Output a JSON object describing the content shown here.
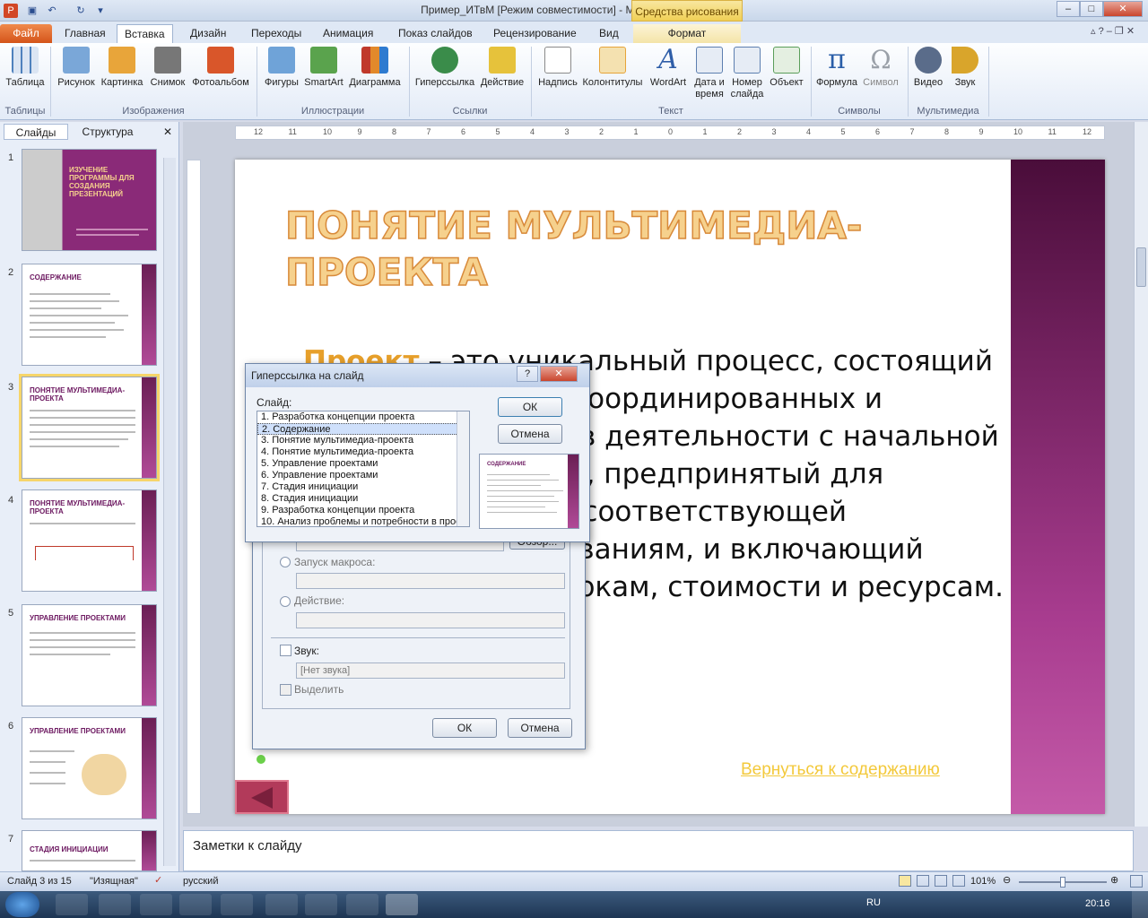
{
  "window": {
    "title": "Пример_ИТвМ [Режим совместимости] - Microsoft PowerPoint",
    "contextual_group": "Средства рисования"
  },
  "tabs": [
    "Файл",
    "Главная",
    "Вставка",
    "Дизайн",
    "Переходы",
    "Анимация",
    "Показ слайдов",
    "Рецензирование",
    "Вид",
    "Формат"
  ],
  "ribbon": {
    "buttons": [
      {
        "label": "Таблица",
        "icon": "table-icon",
        "color": "#4f81bd"
      },
      {
        "label": "Рисунок",
        "icon": "picture-icon",
        "color": "#7aa7d8"
      },
      {
        "label": "Картинка",
        "icon": "clipart-icon",
        "color": "#e8a53a"
      },
      {
        "label": "Снимок",
        "icon": "screenshot-icon",
        "color": "#777777"
      },
      {
        "label": "Фотоальбом",
        "icon": "photo-album-icon",
        "color": "#d9562a"
      },
      {
        "label": "Фигуры",
        "icon": "shapes-icon",
        "color": "#6fa3d8"
      },
      {
        "label": "SmartArt",
        "icon": "smartart-icon",
        "color": "#5aa34d"
      },
      {
        "label": "Диаграмма",
        "icon": "chart-icon",
        "color": "#e2892b"
      },
      {
        "label": "Гиперссылка",
        "icon": "hyperlink-icon",
        "color": "#3a8c4a"
      },
      {
        "label": "Действие",
        "icon": "action-icon",
        "color": "#e6c23b"
      },
      {
        "label": "Надпись",
        "icon": "textbox-icon",
        "color": "#8a8a8a"
      },
      {
        "label": "Колонтитулы",
        "icon": "header-footer-icon",
        "color": "#e7a43a"
      },
      {
        "label": "WordArt",
        "icon": "wordart-icon",
        "color": "#2f5ea8"
      },
      {
        "label": "Дата и время",
        "icon": "datetime-icon",
        "color": "#5d7fb0"
      },
      {
        "label": "Номер слайда",
        "icon": "slide-number-icon",
        "color": "#5d7fb0"
      },
      {
        "label": "Объект",
        "icon": "object-icon",
        "color": "#5a9e5a"
      },
      {
        "label": "Формула",
        "icon": "formula-icon",
        "color": "#2a5ea8"
      },
      {
        "label": "Символ",
        "icon": "symbol-icon",
        "color": "#9aa0a8"
      },
      {
        "label": "Видео",
        "icon": "video-icon",
        "color": "#5a6c8a"
      },
      {
        "label": "Звук",
        "icon": "sound-icon",
        "color": "#d9a52b"
      }
    ],
    "groups": [
      "Таблицы",
      "Изображения",
      "Иллюстрации",
      "Ссылки",
      "Текст",
      "Символы",
      "Мультимедиа"
    ],
    "formula_glyph": "π",
    "symbol_glyph": "Ω",
    "wordart_glyph": "A"
  },
  "panel": {
    "tab_slides": "Слайды",
    "tab_outline": "Структура",
    "close": "✕"
  },
  "thumbnails": [
    {
      "num": "1",
      "title": "ИЗУЧЕНИЕ ПРОГРАММЫ ДЛЯ СОЗДАНИЯ ПРЕЗЕНТАЦИЙ"
    },
    {
      "num": "2",
      "title": "СОДЕРЖАНИЕ"
    },
    {
      "num": "3",
      "title": "ПОНЯТИЕ МУЛЬТИМЕДИА-ПРОЕКТА"
    },
    {
      "num": "4",
      "title": "ПОНЯТИЕ МУЛЬТИМЕДИА-ПРОЕКТА"
    },
    {
      "num": "5",
      "title": "УПРАВЛЕНИЕ ПРОЕКТАМИ"
    },
    {
      "num": "6",
      "title": "УПРАВЛЕНИЕ ПРОЕКТАМИ"
    },
    {
      "num": "7",
      "title": "СТАДИЯ ИНИЦИАЦИИ"
    }
  ],
  "ruler": {
    "h": [
      "12",
      "11",
      "10",
      "9",
      "8",
      "7",
      "6",
      "5",
      "4",
      "3",
      "2",
      "1",
      "0",
      "1",
      "2",
      "3",
      "4",
      "5",
      "6",
      "7",
      "8",
      "9",
      "10",
      "11",
      "12"
    ]
  },
  "slide": {
    "title": "Понятие мультимедиа-проекта",
    "term": "Проект",
    "body": " – это уникальный процесс, состоящий из совокупности скоординированных и управляемых видов деятельности с начальной и конечной датами, предпринятый для достижения цели, соответствующей конкретным требованиям, и включающий ограничения по срокам, стоимости и ресурсам.",
    "return_link": "Вернуться к содержанию"
  },
  "dialog_main": {
    "run_macro": "Запуск макроса:",
    "action": "Действие:",
    "sound": "Звук:",
    "sound_value": "[Нет звука]",
    "highlight": "Выделить",
    "ok": "ОК",
    "cancel": "Отмена",
    "browse": "Обзор..."
  },
  "dialog_link": {
    "title": "Гиперссылка на слайд",
    "help": "?",
    "close": "✕",
    "list_label": "Слайд:",
    "items": [
      "1. Разработка  концепции проекта",
      "2. Содержание",
      "3. Понятие мультимедиа-проекта",
      "4. Понятие мультимедиа-проекта",
      "5. Управление проектами",
      "6. Управление проектами",
      "7. Стадия инициации",
      "8. Стадия инициации",
      "9. Разработка концепции проекта",
      "10. Анализ проблемы и потребности в проекте"
    ],
    "ok": "ОК",
    "cancel": "Отмена",
    "preview_title": "СОДЕРЖАНИЕ"
  },
  "notes": {
    "placeholder": "Заметки к слайду"
  },
  "status": {
    "slide": "Слайд 3 из 15",
    "theme": "\"Изящная\"",
    "lang": "русский",
    "zoom": "101%",
    "zoom_level": 0.5
  },
  "taskbar": {
    "lang": "RU",
    "time": "20:16"
  }
}
